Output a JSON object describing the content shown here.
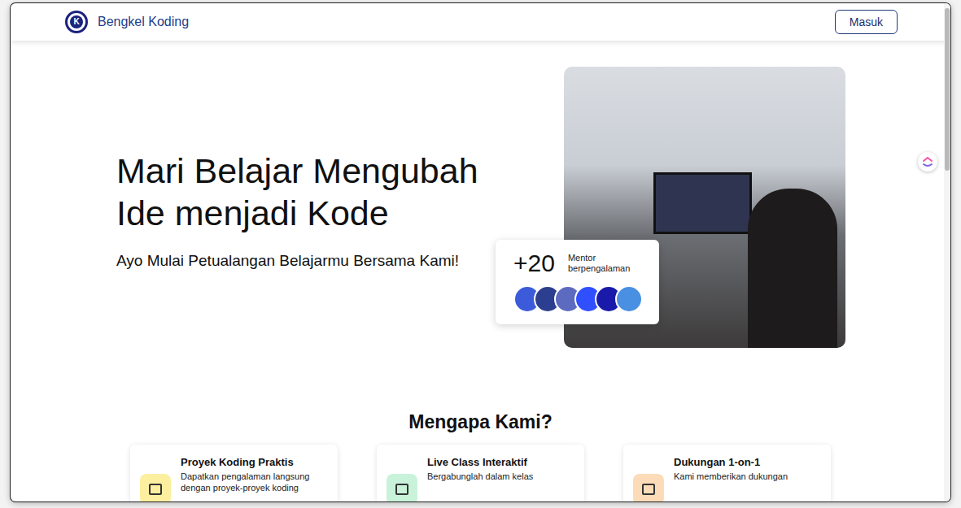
{
  "nav": {
    "logo_letter": "K",
    "brand": "Bengkel Koding",
    "login_button": "Masuk"
  },
  "hero": {
    "title_lines": [
      "Mari Belajar Mengubah",
      "Ide menjadi Kode"
    ],
    "subtitle": "Ayo Mulai Petualangan Belajarmu Bersama Kami!"
  },
  "mentor_card": {
    "count": "+20",
    "label": "Mentor berpengalaman",
    "avatars": 6
  },
  "why": {
    "title": "Mengapa Kami?",
    "features": [
      {
        "title": "Proyek Koding Praktis",
        "description": "Dapatkan pengalaman langsung dengan proyek-proyek koding",
        "color": "#fcef9f"
      },
      {
        "title": "Live Class Interaktif",
        "description": "Bergabunglah dalam kelas",
        "color": "#c8f2da"
      },
      {
        "title": "Dukungan 1-on-1",
        "description": "Kami memberikan dukungan",
        "color": "#fcdcb8"
      }
    ]
  }
}
